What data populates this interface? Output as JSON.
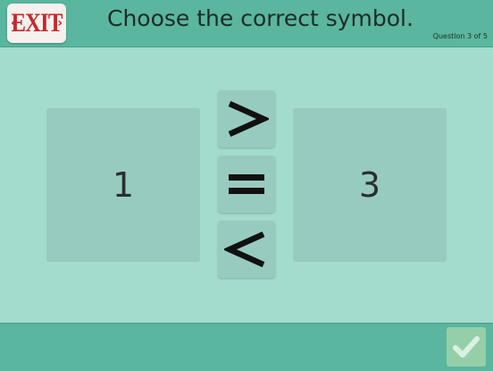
{
  "header": {
    "exit_label": "EXIT",
    "title": "Choose the correct symbol.",
    "progress": "Question 3 of 5"
  },
  "question": {
    "left_value": "1",
    "right_value": "3"
  },
  "symbols": [
    "greater-than",
    "equals",
    "less-than"
  ],
  "footer": {
    "submit_icon": "check-icon"
  },
  "colors": {
    "header_bg": "#5ab69f",
    "body_bg": "#a3dbcd",
    "tile_bg": "#98cbbf",
    "exit_red": "#c8262c",
    "check_bg": "#94cfaa"
  }
}
